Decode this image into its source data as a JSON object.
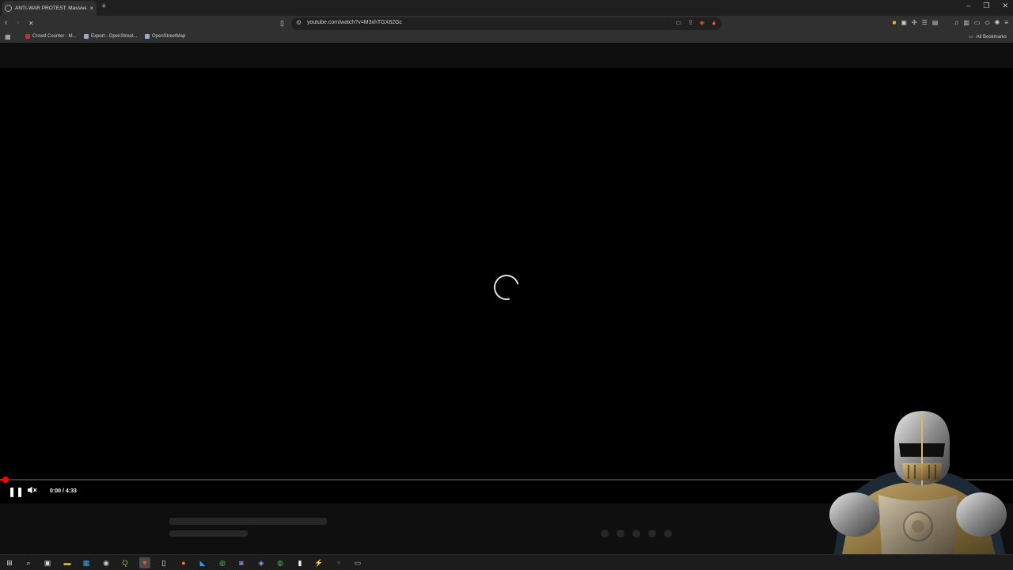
{
  "browser": {
    "tab": {
      "title": "ANTI-WAR PROTEST: Massive P",
      "close": "×"
    },
    "new_tab": "+",
    "window_controls": {
      "minimize": "–",
      "restore": "❐",
      "close": "✕"
    },
    "nav": {
      "back": "‹",
      "forward": "›",
      "reload": "✕"
    },
    "bookmark_star": "▯",
    "url": "youtube.com/watch?v=M3xhTGX82Gc",
    "omnibox_icons": {
      "tune": "⚙",
      "install": "▭",
      "share": "⇪",
      "shield": "◈",
      "rewards": "▲"
    },
    "bookmarks": [
      {
        "label": "Crowd Counter - M..."
      },
      {
        "label": "Export - OpenStreet..."
      },
      {
        "label": "OpenStreetMap"
      }
    ],
    "all_bookmarks": "All Bookmarks"
  },
  "player": {
    "time": "0:00 / 4:33",
    "progress": 0.005,
    "play_icon": "❚❚",
    "volume_icon": "🔇"
  },
  "colors": {
    "accent_red": "#ff0000",
    "background": "#000000",
    "page_bg": "#0f0f0f"
  }
}
